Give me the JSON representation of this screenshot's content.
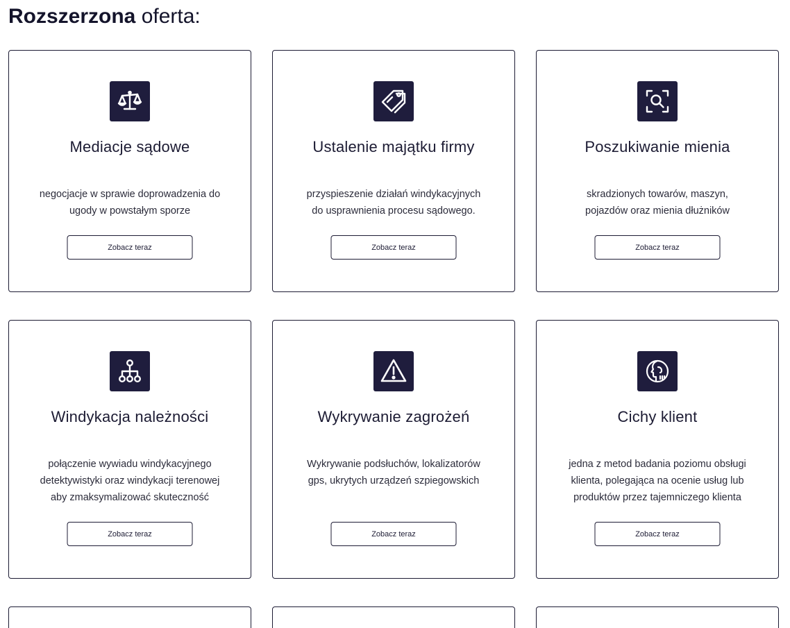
{
  "heading": {
    "bold": "Rozszerzona",
    "light": "oferta:"
  },
  "cards": [
    {
      "icon": "scales-icon",
      "title": "Mediacje sądowe",
      "desc_lines": [
        "negocjacje w sprawie doprowadzenia do",
        "ugody w powstałym sporze"
      ],
      "button": "Zobacz teraz"
    },
    {
      "icon": "price-tag-icon",
      "title": "Ustalenie majątku firmy",
      "desc_lines": [
        "przyspieszenie działań windykacyjnych",
        "do usprawnienia procesu sądowego."
      ],
      "button": "Zobacz teraz"
    },
    {
      "icon": "scan-search-icon",
      "title": "Poszukiwanie mienia",
      "desc_lines": [
        "skradzionych towarów, maszyn,",
        "pojazdów oraz mienia dłużników"
      ],
      "button": "Zobacz teraz"
    },
    {
      "icon": "hierarchy-icon",
      "title": "Windykacja należności",
      "desc_lines": [
        "połączenie wywiadu windykacyjnego",
        "detektywistyki oraz windykacji terenowej",
        "aby zmaksymalizować skuteczność"
      ],
      "button": "Zobacz teraz"
    },
    {
      "icon": "warning-triangle-icon",
      "title": "Wykrywanie zagrożeń",
      "desc_lines": [
        "Wykrywanie podsłuchów, lokalizatorów",
        "gps, ukrytych urządzeń szpiegowskich"
      ],
      "button": "Zobacz teraz"
    },
    {
      "icon": "silent-head-icon",
      "title": "Cichy klient",
      "desc_lines": [
        "jedna z metod badania poziomu obsługi",
        "klienta, polegająca na ocenie usług lub",
        "produktów przez tajemniczego klienta"
      ],
      "button": "Zobacz teraz"
    }
  ],
  "colors": {
    "icon_bg": "#1f1d3d",
    "border": "#1c1b33",
    "text": "#1c1b33"
  }
}
